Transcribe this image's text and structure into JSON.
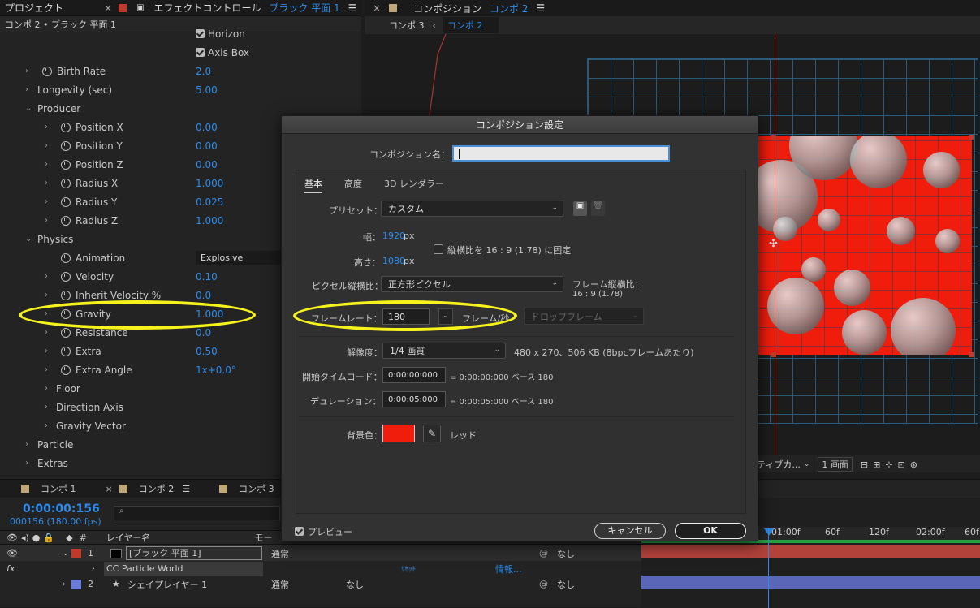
{
  "left_panel": {
    "tab_project": "プロジェクト",
    "tab_effect_prefix": "エフェクトコントロール",
    "tab_effect_layer": "ブラック 平面 1",
    "layer_path": "コンポ 2 • ブラック 平面 1",
    "rows": [
      {
        "label": "Horizon",
        "value": "",
        "type": "checkbox"
      },
      {
        "label": "Axis Box",
        "value": "",
        "type": "checkbox"
      },
      {
        "label": "Birth Rate",
        "value": "2.0",
        "type": "prop1"
      },
      {
        "label": "Longevity (sec)",
        "value": "5.00",
        "type": "group1"
      },
      {
        "label": "Producer",
        "value": "",
        "type": "head"
      },
      {
        "label": "Position X",
        "value": "0.00",
        "type": "prop2"
      },
      {
        "label": "Position Y",
        "value": "0.00",
        "type": "prop2"
      },
      {
        "label": "Position Z",
        "value": "0.00",
        "type": "prop2"
      },
      {
        "label": "Radius X",
        "value": "1.000",
        "type": "prop2"
      },
      {
        "label": "Radius Y",
        "value": "0.025",
        "type": "prop2"
      },
      {
        "label": "Radius Z",
        "value": "1.000",
        "type": "prop2"
      },
      {
        "label": "Physics",
        "value": "",
        "type": "head"
      },
      {
        "label": "Animation",
        "value": "Explosive",
        "type": "select"
      },
      {
        "label": "Velocity",
        "value": "0.10",
        "type": "prop2"
      },
      {
        "label": "Inherit Velocity %",
        "value": "0.0",
        "type": "prop2"
      },
      {
        "label": "Gravity",
        "value": "1.000",
        "type": "prop2"
      },
      {
        "label": "Resistance",
        "value": "0.0",
        "type": "prop2"
      },
      {
        "label": "Extra",
        "value": "0.50",
        "type": "prop2"
      },
      {
        "label": "Extra Angle",
        "value": "1x+0.0°",
        "type": "prop2"
      },
      {
        "label": "Floor",
        "value": "",
        "type": "sub"
      },
      {
        "label": "Direction Axis",
        "value": "",
        "type": "sub"
      },
      {
        "label": "Gravity Vector",
        "value": "",
        "type": "sub"
      },
      {
        "label": "Particle",
        "value": "",
        "type": "group1"
      },
      {
        "label": "Extras",
        "value": "",
        "type": "group1"
      }
    ]
  },
  "comp_panel": {
    "tab_prefix": "コンポジション",
    "tab_name": "コンポ 2",
    "breadcrumb_1": "コンポ 3",
    "breadcrumb_2": "コンポ 2",
    "viewer_toolbar": {
      "view": "ティブカ...",
      "views": "1 画面"
    }
  },
  "timeline": {
    "tabs": [
      "コンポ 1",
      "コンポ 2",
      "コンポ 3"
    ],
    "timecode": "0:00:00:156",
    "frames": "000156 (180.00 fps)",
    "search_placeholder": "",
    "col_layer_name": "レイヤー名",
    "col_mode": "モー",
    "ruler": [
      "01:00f",
      "60f",
      "120f",
      "02:00f",
      "60f"
    ],
    "layers": [
      {
        "num": "1",
        "name": "[ブラック 平面 1]",
        "mode": "通常",
        "parent": "なし",
        "color": "#c0392b"
      },
      {
        "num": "2",
        "name": "シェイプレイヤー 1",
        "mode": "通常",
        "trkmat": "なし",
        "parent": "なし",
        "color": "#6b7bd6"
      }
    ],
    "effect_name": "CC Particle World",
    "effect_reset": "ﾘｾｯﾄ",
    "effect_info": "情報..."
  },
  "dialog": {
    "title": "コンポジション設定",
    "name_label": "コンポジション名：",
    "name_value": "",
    "tabs": [
      "基本",
      "高度",
      "3D レンダラー"
    ],
    "preset_label": "プリセット：",
    "preset_value": "カスタム",
    "width_label": "幅：",
    "width_value": "1920",
    "height_label": "高さ：",
    "height_value": "1080",
    "px": "px",
    "lock_aspect": "縦横比を 16 : 9 (1.78) に固定",
    "pixel_aspect_label": "ピクセル縦横比：",
    "pixel_aspect_value": "正方形ピクセル",
    "frame_aspect_label": "フレーム縦横比：",
    "frame_aspect_value": "16 : 9 (1.78)",
    "frame_rate_label": "フレームレート：",
    "frame_rate_value": "180",
    "frame_per_sec": "フレーム/秒",
    "drop_frame": "ドロップフレーム",
    "resolution_label": "解像度：",
    "resolution_value": "1/4 画質",
    "resolution_info": "480 x 270、506 KB (8bpcフレームあたり)",
    "start_tc_label": "開始タイムコード：",
    "start_tc_value": "0:00:00:000",
    "start_tc_info": "= 0:00:00:000  ベース 180",
    "duration_label": "デュレーション：",
    "duration_value": "0:00:05:000",
    "duration_info": "= 0:00:05:000  ベース 180",
    "bg_label": "背景色：",
    "bg_color": "#f01c0c",
    "bg_name": "レッド",
    "preview_label": "プレビュー",
    "cancel": "キャンセル",
    "ok": "OK"
  },
  "highlight_color": "#f5f21c"
}
